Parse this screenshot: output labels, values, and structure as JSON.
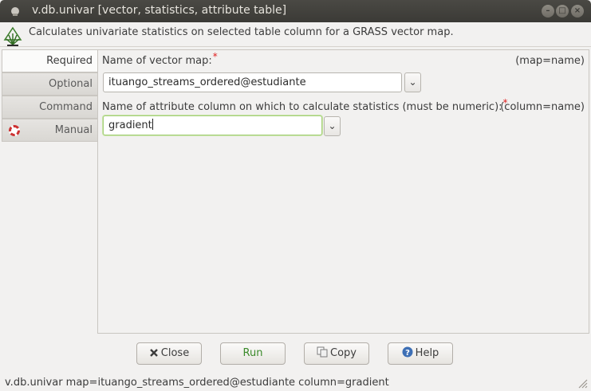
{
  "window": {
    "title": "v.db.univar [vector, statistics, attribute table]"
  },
  "header": {
    "description": "Calculates univariate statistics on selected table column for a GRASS vector map.",
    "icon": "grass-logo-icon"
  },
  "tabs": [
    {
      "label": "Required",
      "active": true
    },
    {
      "label": "Optional",
      "active": false
    },
    {
      "label": "Command output",
      "active": false
    },
    {
      "label": "Manual",
      "active": false,
      "icon": "lifebuoy-icon"
    }
  ],
  "form": {
    "map": {
      "label": "Name of vector map:",
      "required_mark": "*",
      "hint": "(map=name)",
      "value": "ituango_streams_ordered@estudiante"
    },
    "column": {
      "label": "Name of attribute column on which to calculate statistics (must be numeric):",
      "required_mark": "*",
      "hint": "(column=name)",
      "value": "gradient"
    }
  },
  "buttons": {
    "close": "Close",
    "run": "Run",
    "copy": "Copy",
    "help": "Help"
  },
  "status": {
    "command": "v.db.univar map=ituango_streams_ordered@estudiante column=gradient"
  },
  "colors": {
    "titlebar": "#3b3a36",
    "required_mark": "#e02020",
    "run_text": "#3a8a2a",
    "focus_border": "#a5cf7a"
  }
}
